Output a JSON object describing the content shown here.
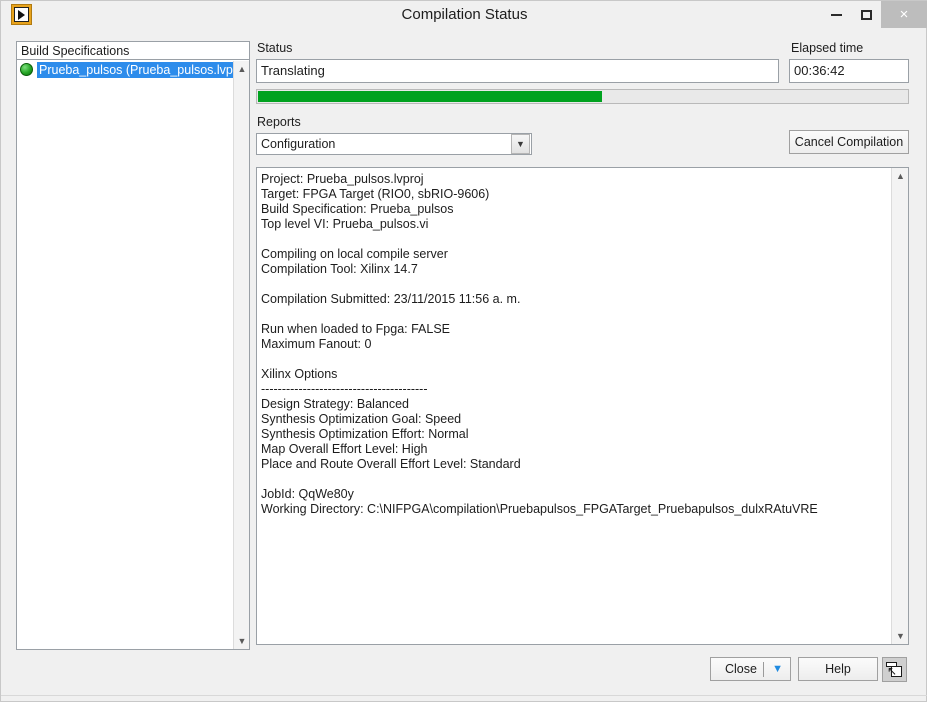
{
  "window": {
    "title": "Compilation Status",
    "icon": "labview-vi-icon",
    "controls": {
      "minimize": "minimize-icon",
      "maximize": "maximize-icon",
      "close": "×"
    }
  },
  "build_panel": {
    "header": "Build Specifications",
    "items": [
      {
        "label": "Prueba_pulsos (Prueba_pulsos.lvpr",
        "status_icon": "green-circle-icon",
        "selected": true
      }
    ],
    "scroll": {
      "up": "▲",
      "down": "▼"
    }
  },
  "status": {
    "label": "Status",
    "value": "Translating",
    "placeholder": "",
    "progress_percent": 53
  },
  "elapsed": {
    "label": "Elapsed time",
    "value": "00:36:42",
    "placeholder": ""
  },
  "reports": {
    "label": "Reports",
    "selected": "Configuration",
    "options": [
      "Configuration"
    ],
    "arrow": "▼"
  },
  "actions": {
    "cancel_compilation": "Cancel Compilation",
    "close": "Close",
    "close_caret": "▼",
    "help": "Help",
    "arrange_windows": "window-arrange-icon"
  },
  "log": {
    "scroll": {
      "up": "▲",
      "down": "▼"
    },
    "text": "Project: Prueba_pulsos.lvproj\nTarget: FPGA Target (RIO0, sbRIO-9606)\nBuild Specification: Prueba_pulsos\nTop level VI: Prueba_pulsos.vi\n\nCompiling on local compile server\nCompilation Tool: Xilinx 14.7\n\nCompilation Submitted: 23/11/2015 11:56 a. m.\n\nRun when loaded to Fpga: FALSE\nMaximum Fanout: 0\n\nXilinx Options\n----------------------------------------\nDesign Strategy: Balanced\nSynthesis Optimization Goal: Speed\nSynthesis Optimization Effort: Normal\nMap Overall Effort Level: High\nPlace and Route Overall Effort Level: Standard\n\nJobId: QqWe80y\nWorking Directory: C:\\NIFPGA\\compilation\\Pruebapulsos_FPGATarget_Pruebapulsos_dulxRAtuVRE"
  },
  "colors": {
    "accent_green": "#00a21f",
    "selection_blue": "#2d8ceb",
    "caret_blue": "#1f8ae0",
    "window_bg": "#f0f0f0"
  }
}
